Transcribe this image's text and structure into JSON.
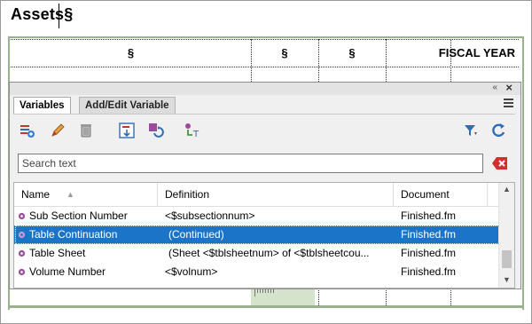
{
  "document": {
    "title": "Assets§",
    "header": {
      "col1": "§",
      "col2": "§",
      "col3": "§",
      "col4": "FISCAL YEAR"
    }
  },
  "panel": {
    "tabs": [
      {
        "label": "Variables",
        "active": true
      },
      {
        "label": "Add/Edit Variable",
        "active": false
      }
    ],
    "toolbar_icons": [
      "new-variable-icon",
      "edit-icon",
      "delete-icon",
      "insert-variable-icon",
      "convert-variable-icon",
      "update-variables-icon",
      "filter-icon",
      "refresh-icon"
    ],
    "search": {
      "placeholder": "Search text",
      "value": ""
    },
    "columns": {
      "name": "Name",
      "definition": "Definition",
      "document": "Document"
    },
    "rows": [
      {
        "name": "Sub Section Number",
        "definition": "<$subsectionnum>",
        "document": "Finished.fm",
        "selected": false
      },
      {
        "name": "Table Continuation",
        "definition": "(Continued)",
        "document": "Finished.fm",
        "selected": true
      },
      {
        "name": "Table Sheet",
        "definition": "(Sheet <$tblsheetnum> of <$tblsheetcou...",
        "document": "Finished.fm",
        "selected": false
      },
      {
        "name": "Volume Number",
        "definition": "<$volnum>",
        "document": "Finished.fm",
        "selected": false
      }
    ]
  },
  "colors": {
    "selection": "#1c74c9",
    "table_border": "#9bb08f",
    "variable_icon": "#9c4a9a"
  }
}
